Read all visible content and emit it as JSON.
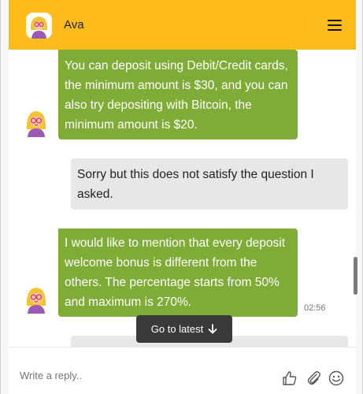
{
  "header": {
    "agent_name": "Ava"
  },
  "messages": [
    {
      "sender": "bot",
      "text": "You can deposit using Debit/Credit cards, the minimum amount is $30, and you can also try depositing with Bitcoin, the minimum amount is $20."
    },
    {
      "sender": "user",
      "text": "Sorry but this does not satisfy the question I asked."
    },
    {
      "sender": "bot",
      "text": "I would like to mention that every deposit welcome bonus is different from the others. The percentage starts from 50% and maximum is 270%.",
      "time": "02:56"
    },
    {
      "sender": "user",
      "text": ""
    }
  ],
  "go_to_latest_label": "Go to latest",
  "composer": {
    "placeholder": "Write a reply.."
  },
  "icons": {
    "menu": "hamburger-icon",
    "thumb": "thumbs-up-icon",
    "attach": "paperclip-icon",
    "emoji": "smiley-icon",
    "arrow": "arrow-down-icon"
  },
  "colors": {
    "header": "#fdbb1c",
    "bot_bubble": "#7fac37",
    "user_bubble": "#e7e7e7"
  }
}
